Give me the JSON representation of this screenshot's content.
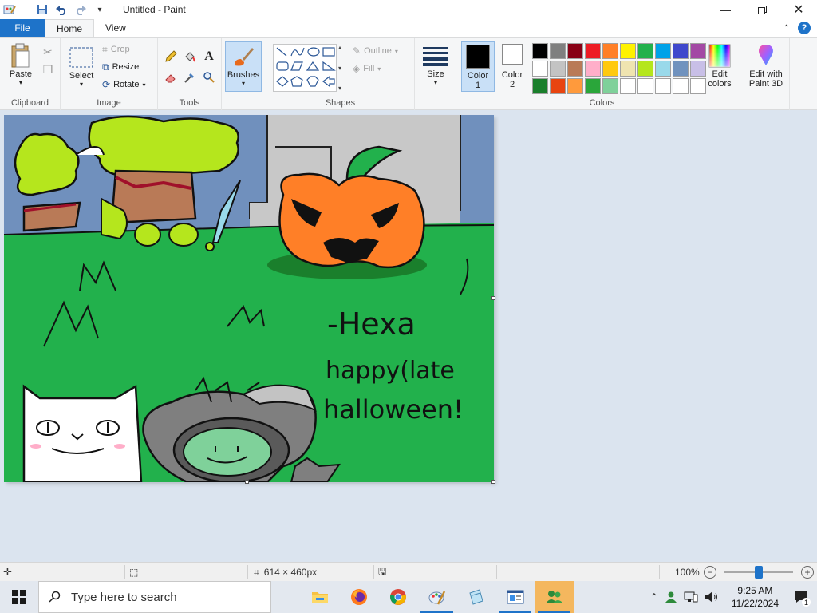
{
  "window": {
    "title": "Untitled - Paint"
  },
  "tabs": {
    "file": "File",
    "home": "Home",
    "view": "View"
  },
  "ribbon": {
    "clipboard": {
      "label": "Clipboard",
      "paste": "Paste"
    },
    "image": {
      "label": "Image",
      "select": "Select",
      "crop": "Crop",
      "resize": "Resize",
      "rotate": "Rotate"
    },
    "tools": {
      "label": "Tools"
    },
    "brushes": {
      "label": "Brushes"
    },
    "shapes": {
      "label": "Shapes",
      "outline": "Outline",
      "fill": "Fill"
    },
    "size": {
      "label": "Size"
    },
    "colors": {
      "label": "Colors",
      "color1_label": "Color",
      "color1_num": "1",
      "color2_label": "Color",
      "color2_num": "2",
      "color1_value": "#000000",
      "color2_value": "#ffffff",
      "edit_colors_line1": "Edit",
      "edit_colors_line2": "colors",
      "paint3d_line1": "Edit with",
      "paint3d_line2": "Paint 3D",
      "palette": [
        "#000000",
        "#7f7f7f",
        "#880015",
        "#ed1c24",
        "#ff7f27",
        "#fff200",
        "#22b14c",
        "#00a2e8",
        "#3f48cc",
        "#a349a4",
        "#ffffff",
        "#c3c3c3",
        "#b97a57",
        "#ffaec9",
        "#ffc90e",
        "#efe4b0",
        "#b5e61d",
        "#99d9ea",
        "#7092be",
        "#c8bfe7",
        "#1a7f2c",
        "#e84410",
        "#ff9a3c",
        "#2aa63a",
        "#7fd19a",
        "#ffffff",
        "#ffffff",
        "#ffffff",
        "#ffffff",
        "#ffffff"
      ]
    }
  },
  "canvas": {
    "signature": "-Hexa",
    "message_line1": "happy(late",
    "message_line2": "halloween!"
  },
  "status": {
    "dimensions": "614 × 460px",
    "zoom": "100%"
  },
  "taskbar": {
    "search_placeholder": "Type here to search",
    "time": "9:25 AM",
    "date": "11/22/2024",
    "notification_count": "1"
  }
}
